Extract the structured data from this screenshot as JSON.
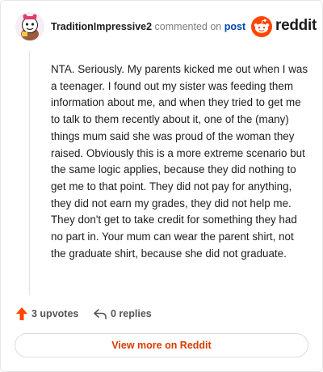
{
  "comment": {
    "username": "TraditionImpressive2",
    "action_text": "commented on",
    "post_link": "post",
    "body": "NTA. Seriously. My parents kicked me out when I was a teenager. I found out my sister was feeding them information about me, and when they tried to get me to talk to them recently about it, one of the (many) things mum said she was proud of the woman they raised. Obviously this is a more extreme scenario but the same logic applies, because they did nothing to get me to that point. They did not pay for anything, they did not earn my grades, they did not help me. They don't get to take credit for something they had no part in. Your mum can wear the parent shirt, not the graduate shirt, because she did not graduate."
  },
  "brand": {
    "name": "reddit",
    "icon": "reddit-logo-icon",
    "color": "#ff4500"
  },
  "actions": {
    "upvotes_label": "3 upvotes",
    "replies_label": "0 replies",
    "upvote_icon": "upvote-arrow-icon",
    "reply_icon": "reply-arrow-icon"
  },
  "footer": {
    "view_more_label": "View more on Reddit"
  },
  "colors": {
    "accent": "#ff4500",
    "link": "#0045ac",
    "button_text": "#d93a00"
  }
}
